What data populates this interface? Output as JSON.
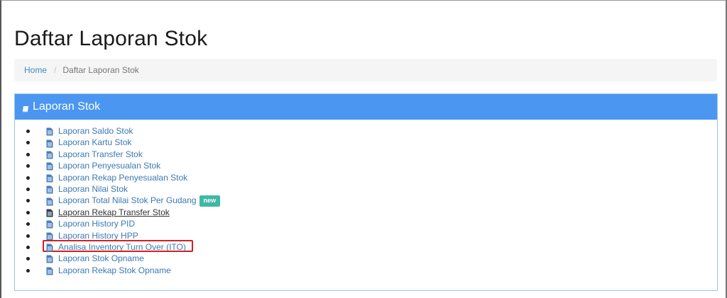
{
  "page": {
    "title": "Daftar Laporan Stok"
  },
  "breadcrumb": {
    "home": "Home",
    "separator": "/",
    "current": "Daftar Laporan Stok"
  },
  "panel": {
    "title": "Laporan Stok",
    "icon": "book-icon",
    "items": [
      {
        "label": "Laporan Saldo Stok",
        "icon": "document-icon"
      },
      {
        "label": "Laporan Kartu Stok",
        "icon": "document-icon"
      },
      {
        "label": "Laporan Transfer Stok",
        "icon": "document-icon"
      },
      {
        "label": "Laporan Penyesualan Stok",
        "icon": "document-icon"
      },
      {
        "label": "Laporan Rekap Penyesualan Stok",
        "icon": "document-icon"
      },
      {
        "label": "Laporan Nilai Stok",
        "icon": "document-icon"
      },
      {
        "label": "Laporan Total Nilai Stok Per Gudang",
        "icon": "document-icon",
        "badge": "new"
      },
      {
        "label": "Laporan Rekap Transfer Stok",
        "icon": "document-icon"
      },
      {
        "label": "Laporan History PID",
        "icon": "document-icon"
      },
      {
        "label": "Laporan History HPP",
        "icon": "document-icon"
      },
      {
        "label": "Analisa Inventory Turn Over (ITO)",
        "icon": "document-icon"
      },
      {
        "label": "Laporan Stok Opname",
        "icon": "document-icon"
      },
      {
        "label": "Laporan Rekap Stok Opname",
        "icon": "document-icon"
      }
    ]
  },
  "colors": {
    "panel_header": "#4b96f0",
    "link": "#3c78b4",
    "badge": "#3fb8a6",
    "highlight": "#d42020"
  }
}
